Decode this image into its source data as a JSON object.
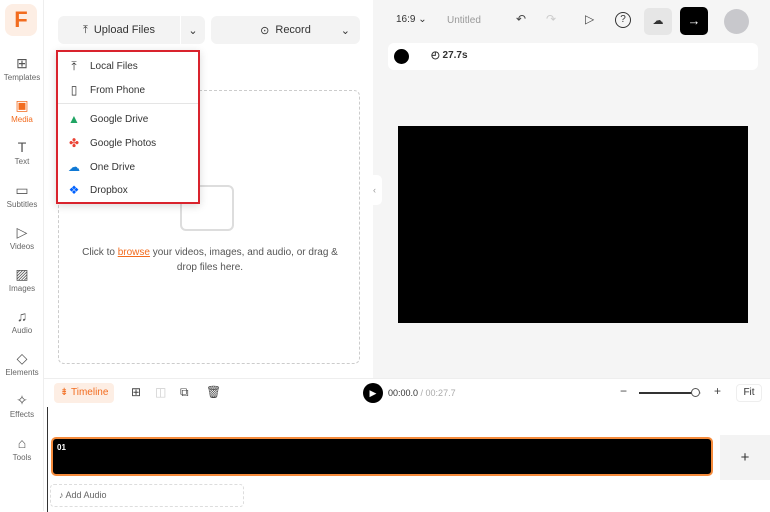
{
  "sidebar": {
    "logo": "F",
    "items": [
      {
        "label": "Templates",
        "icon": "templates-icon",
        "glyph": "⊞"
      },
      {
        "label": "Media",
        "icon": "media-folder-icon",
        "glyph": "▣"
      },
      {
        "label": "Text",
        "icon": "text-icon",
        "glyph": "T"
      },
      {
        "label": "Subtitles",
        "icon": "subtitles-icon",
        "glyph": "▭"
      },
      {
        "label": "Videos",
        "icon": "videos-icon",
        "glyph": "▷"
      },
      {
        "label": "Images",
        "icon": "images-icon",
        "glyph": "▨"
      },
      {
        "label": "Audio",
        "icon": "audio-icon",
        "glyph": "♫"
      },
      {
        "label": "Elements",
        "icon": "elements-icon",
        "glyph": "◇"
      },
      {
        "label": "Effects",
        "icon": "effects-icon",
        "glyph": "✧"
      },
      {
        "label": "Tools",
        "icon": "tools-icon",
        "glyph": "⌂"
      }
    ],
    "active": "Media"
  },
  "panel": {
    "upload_label": "Upload Files",
    "record_label": "Record",
    "drop_prefix": "Click to ",
    "drop_link": "browse",
    "drop_suffix": " your videos, images, and audio, or drag & drop files here."
  },
  "menu": {
    "items": [
      {
        "label": "Local Files",
        "glyph": "⤒",
        "color": "#333"
      },
      {
        "label": "From Phone",
        "glyph": "▯",
        "color": "#333"
      },
      {
        "label": "Google Drive",
        "glyph": "▲",
        "color": "#1fa463"
      },
      {
        "label": "Google Photos",
        "glyph": "✤",
        "color": "#ea4335"
      },
      {
        "label": "One Drive",
        "glyph": "☁",
        "color": "#0f78d4"
      },
      {
        "label": "Dropbox",
        "glyph": "❖",
        "color": "#0061fe"
      }
    ]
  },
  "topbar": {
    "aspect": "16:9",
    "title": "Untitled"
  },
  "canvas": {
    "duration": "27.7s",
    "background": "#000000"
  },
  "timeline": {
    "tab": "Timeline",
    "current": "00:00.0",
    "total": "/ 00:27.7",
    "fit": "Fit",
    "clip_label": "01",
    "add_audio": "Add Audio",
    "zoom_level": 0.9
  },
  "colors": {
    "accent": "#f26c1f",
    "highlight": "#d9232d"
  }
}
